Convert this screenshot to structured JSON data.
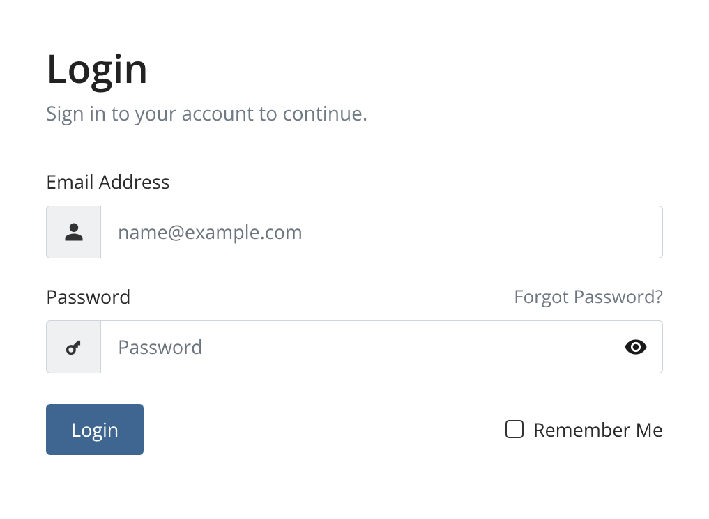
{
  "header": {
    "title": "Login",
    "subtitle": "Sign in to your account to continue."
  },
  "form": {
    "email": {
      "label": "Email Address",
      "placeholder": "name@example.com",
      "value": ""
    },
    "password": {
      "label": "Password",
      "placeholder": "Password",
      "forgot_label": "Forgot Password?",
      "value": ""
    },
    "submit_label": "Login",
    "remember_label": "Remember Me"
  }
}
